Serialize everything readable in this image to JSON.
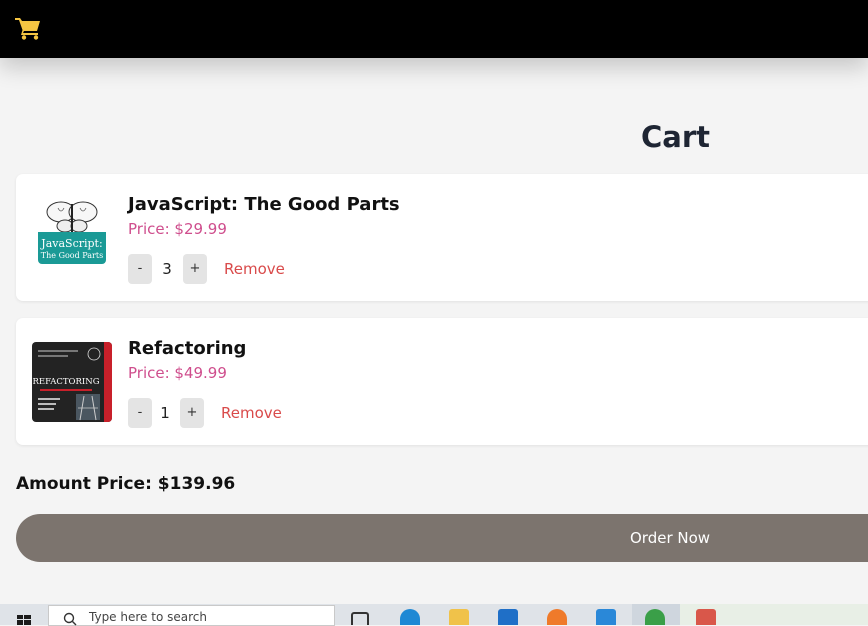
{
  "header": {
    "cart_icon": "shopping-cart-icon",
    "accent_color": "#f5c542"
  },
  "page": {
    "title": "Cart"
  },
  "cart": {
    "items": [
      {
        "title": "JavaScript: The Good Parts",
        "price": "Price: $29.99",
        "quantity": "3",
        "decrement": "-",
        "increment": "+",
        "remove": "Remove",
        "cover": {
          "line1": "JavaScript:",
          "line2": "The Good Parts"
        }
      },
      {
        "title": "Refactoring",
        "price": "Price: $49.99",
        "quantity": "1",
        "decrement": "-",
        "increment": "+",
        "remove": "Remove",
        "cover": {
          "line1": "REFACTORING"
        }
      }
    ],
    "amount": "Amount Price: $139.96",
    "order_label": "Order Now"
  },
  "taskbar": {
    "search_placeholder": "Type here to search",
    "icons": [
      "windows-start-icon",
      "search-icon",
      "task-view-icon",
      "edge-icon",
      "file-explorer-icon",
      "mail-icon",
      "firefox-icon",
      "vscode-icon",
      "chrome-icon",
      "app-icon"
    ]
  },
  "colors": {
    "price": "#cf4e8d",
    "remove": "#d94a4a",
    "order_button": "#7c746e",
    "title": "#1e2533"
  }
}
